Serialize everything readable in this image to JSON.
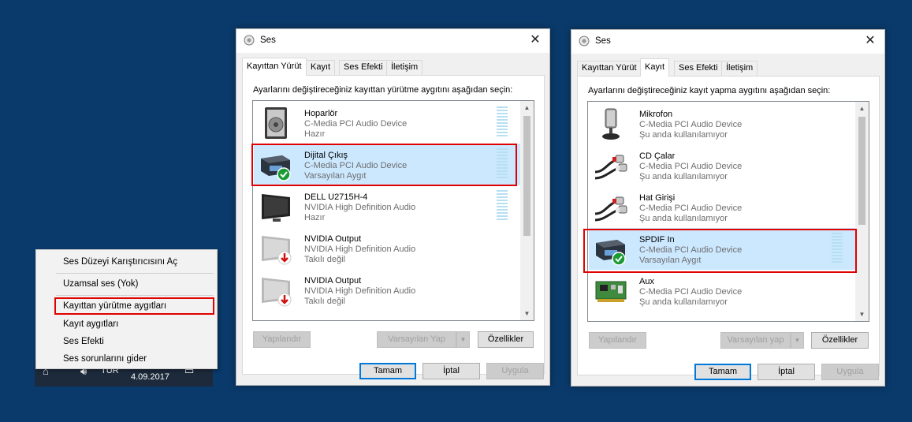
{
  "taskbar": {
    "lang": "TÜR",
    "date": "4.09.2017"
  },
  "context_menu": {
    "items": [
      "Ses Düzeyi Karıştırıcısını Aç",
      "Uzamsal ses (Yok)",
      "Kayıttan yürütme aygıtları",
      "Kayıt aygıtları",
      "Ses Efekti",
      "Ses sorunlarını gider"
    ]
  },
  "dialog_playback": {
    "title": "Ses",
    "tabs": [
      "Kayıttan Yürüt",
      "Kayıt",
      "Ses Efekti",
      "İletişim"
    ],
    "active_tab": "Kayıttan Yürüt",
    "instruction": "Ayarlarını değiştireceğiniz kayıttan yürütme aygıtını aşağıdan seçin:",
    "devices": [
      {
        "name": "Hoparlör",
        "driver": "C-Media PCI Audio Device",
        "status": "Hazır",
        "icon": "speaker-icon"
      },
      {
        "name": "Dijital Çıkış",
        "driver": "C-Media PCI Audio Device",
        "status": "Varsayılan Aygıt",
        "icon": "digital-output-icon",
        "selected": true
      },
      {
        "name": "DELL U2715H-4",
        "driver": "NVIDIA High Definition Audio",
        "status": "Hazır",
        "icon": "monitor-icon"
      },
      {
        "name": "NVIDIA Output",
        "driver": "NVIDIA High Definition Audio",
        "status": "Takılı değil",
        "icon": "monitor-unplugged-icon"
      },
      {
        "name": "NVIDIA Output",
        "driver": "NVIDIA High Definition Audio",
        "status": "Takılı değil",
        "icon": "monitor-unplugged-icon"
      }
    ],
    "buttons": {
      "configure": "Yapılandır",
      "set_default": "Varsayılan Yap",
      "properties": "Özellikler",
      "ok": "Tamam",
      "cancel": "İptal",
      "apply": "Uygula"
    }
  },
  "dialog_recording": {
    "title": "Ses",
    "tabs": [
      "Kayıttan Yürüt",
      "Kayıt",
      "Ses Efekti",
      "İletişim"
    ],
    "active_tab": "Kayıt",
    "instruction": "Ayarlarını değiştireceğiniz kayıt yapma aygıtını aşağıdan seçin:",
    "devices": [
      {
        "name": "Mikrofon",
        "driver": "C-Media PCI Audio Device",
        "status": "Şu anda kullanılamıyor",
        "icon": "microphone-icon"
      },
      {
        "name": "CD Çalar",
        "driver": "C-Media PCI Audio Device",
        "status": "Şu anda kullanılamıyor",
        "icon": "rca-cable-icon"
      },
      {
        "name": "Hat Girişi",
        "driver": "C-Media PCI Audio Device",
        "status": "Şu anda kullanılamıyor",
        "icon": "rca-cable-icon"
      },
      {
        "name": "SPDIF In",
        "driver": "C-Media PCI Audio Device",
        "status": "Varsayılan Aygıt",
        "icon": "digital-input-icon",
        "selected": true
      },
      {
        "name": "Aux",
        "driver": "C-Media PCI Audio Device",
        "status": "Şu anda kullanılamıyor",
        "icon": "sound-card-icon"
      }
    ],
    "buttons": {
      "configure": "Yapılandır",
      "set_default": "Varsayılan yap",
      "properties": "Özellikler",
      "ok": "Tamam",
      "cancel": "İptal",
      "apply": "Uygula"
    }
  },
  "colors": {
    "desktop": "#0a3a6b",
    "selection": "#cce8ff",
    "highlight": "#e00000",
    "meter": "#b7dff2"
  }
}
